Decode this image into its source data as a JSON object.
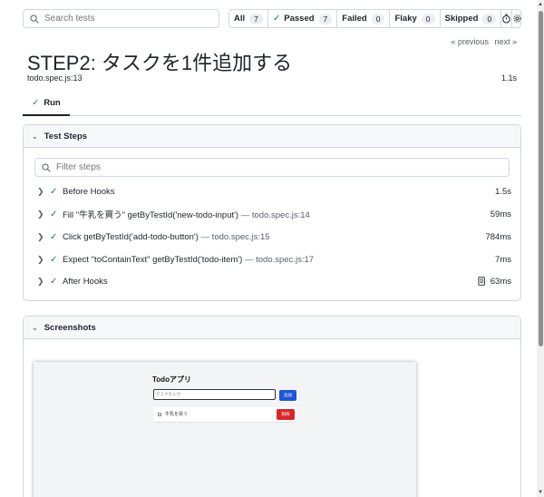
{
  "search": {
    "placeholder": "Search tests"
  },
  "filters": [
    {
      "label": "All",
      "count": "7"
    },
    {
      "label": "Passed",
      "count": "7"
    },
    {
      "label": "Failed",
      "count": "0"
    },
    {
      "label": "Flaky",
      "count": "0"
    },
    {
      "label": "Skipped",
      "count": "0"
    }
  ],
  "toolbar_icons": [
    "stopwatch-icon",
    "gear-icon"
  ],
  "nav": {
    "previous": "« previous",
    "next": "next »"
  },
  "test": {
    "title": "STEP2: タスクを1件追加する",
    "file": "todo.spec.js:13",
    "duration": "1.1s"
  },
  "tabs": [
    {
      "label": "Run"
    }
  ],
  "steps_panel": {
    "title": "Test Steps",
    "filter_placeholder": "Filter steps",
    "steps": [
      {
        "text": "Before Hooks",
        "location": "",
        "time": "1.5s"
      },
      {
        "text": "Fill \"牛乳を買う\" getByTestId('new-todo-input')",
        "location": "— todo.spec.js:14",
        "time": "59ms"
      },
      {
        "text": "Click getByTestId('add-todo-button')",
        "location": "— todo.spec.js:15",
        "time": "784ms"
      },
      {
        "text": "Expect \"toContainText\" getByTestId('todo-item')",
        "location": "— todo.spec.js:17",
        "time": "7ms"
      },
      {
        "text": "After Hooks",
        "location": "",
        "time": "63ms"
      }
    ]
  },
  "screenshots_panel": {
    "title": "Screenshots",
    "app": {
      "title": "Todoアプリ",
      "input_placeholder": "タスクを入力",
      "add_label": "追加",
      "item_text": "牛乳を買う",
      "delete_label": "削除"
    }
  },
  "colors": {
    "success": "#1a7f37",
    "border": "#d0d7de",
    "add_button": "#1e54d6",
    "delete_button": "#d62828"
  }
}
